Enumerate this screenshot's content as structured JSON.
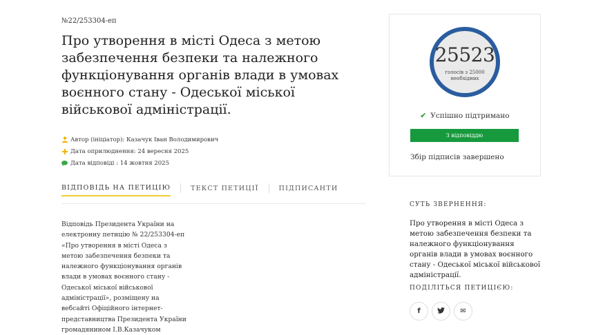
{
  "petition": {
    "number": "№22/253304-еп",
    "title": "Про утворення в місті Одеса з метою забезпечення безпеки та належного функціонування органів влади в умовах воєнного стану - Одеської міської військової адміністрації.",
    "meta": {
      "author": "Автор (ініціатор): Казачук Іван Володимирович",
      "published": "Дата оприлюднення: 24 вересня 2025",
      "answered": "Дата відповіді : 14 жовтня 2025"
    },
    "tabs": [
      "ВІДПОВІДЬ НА ПЕТИЦІЮ",
      "ТЕКСТ ПЕТИЦІЇ",
      "ПІДПИСАНТИ"
    ],
    "answer_text": "Відповідь Президента України на електронну петицію № 22/253304-еп «Про утворення в місті Одеса з метою забезпечення безпеки та належного функціонування органів влади в умовах воєнного стану - Одеської міської військової адміністрації», розміщену на вебсайті Офіційного інтернет-представництва Президента України громадянином І.В.Казачуком"
  },
  "sidebar": {
    "votes": "25523",
    "votes_needed": "голосів з 25000 необхідних",
    "status_success": "Успішно підтримано",
    "status_label": "З відповіддю",
    "collection_done": "Збір підписів завершено",
    "summary_heading": "СУТЬ ЗВЕРНЕННЯ:",
    "summary_text": "Про утворення в місті Одеса з метою забезпечення безпеки та належного функціонування органів влади в умовах воєнного стану - Одеської міської військової адміністрації.",
    "share_heading": "ПОДІЛІТЬСЯ ПЕТИЦІЄЮ:",
    "share_buttons": [
      {
        "icon": "facebook-icon",
        "glyph": "f"
      },
      {
        "icon": "twitter-icon",
        "glyph": "t"
      },
      {
        "icon": "email-icon",
        "glyph": "✉"
      }
    ]
  },
  "colors": {
    "ring": "#2a5d9f",
    "status_bar": "#169a3d",
    "check": "#3aa548",
    "active_tab_underline": "#f0cc2e",
    "author_icon": "#f0b400",
    "date_icon": "#f0b400",
    "answer_icon": "#3aa548"
  }
}
